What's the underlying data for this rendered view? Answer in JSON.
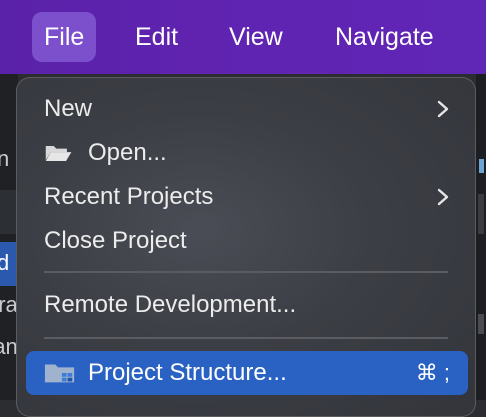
{
  "menubar": {
    "items": [
      {
        "label": "File",
        "active": true
      },
      {
        "label": "Edit",
        "active": false
      },
      {
        "label": "View",
        "active": false
      },
      {
        "label": "Navigate",
        "active": false
      }
    ]
  },
  "background": {
    "left_fragments": [
      "n",
      "d",
      "ora",
      "ran"
    ]
  },
  "file_menu": {
    "items": [
      {
        "label": "New",
        "icon": null,
        "submenu": true
      },
      {
        "label": "Open...",
        "icon": "folder-open-icon",
        "submenu": false
      },
      {
        "label": "Recent Projects",
        "icon": null,
        "submenu": true
      },
      {
        "label": "Close Project",
        "icon": null,
        "submenu": false
      },
      {
        "label": "Remote Development...",
        "icon": null,
        "submenu": false
      },
      {
        "label": "Project Structure...",
        "icon": "project-structure-icon",
        "submenu": false,
        "shortcut": "⌘ ;",
        "selected": true
      }
    ]
  },
  "colors": {
    "menubar": "#5f23b0",
    "active_menubar_item": "#7c4fcc",
    "selection": "#2a62c4"
  }
}
